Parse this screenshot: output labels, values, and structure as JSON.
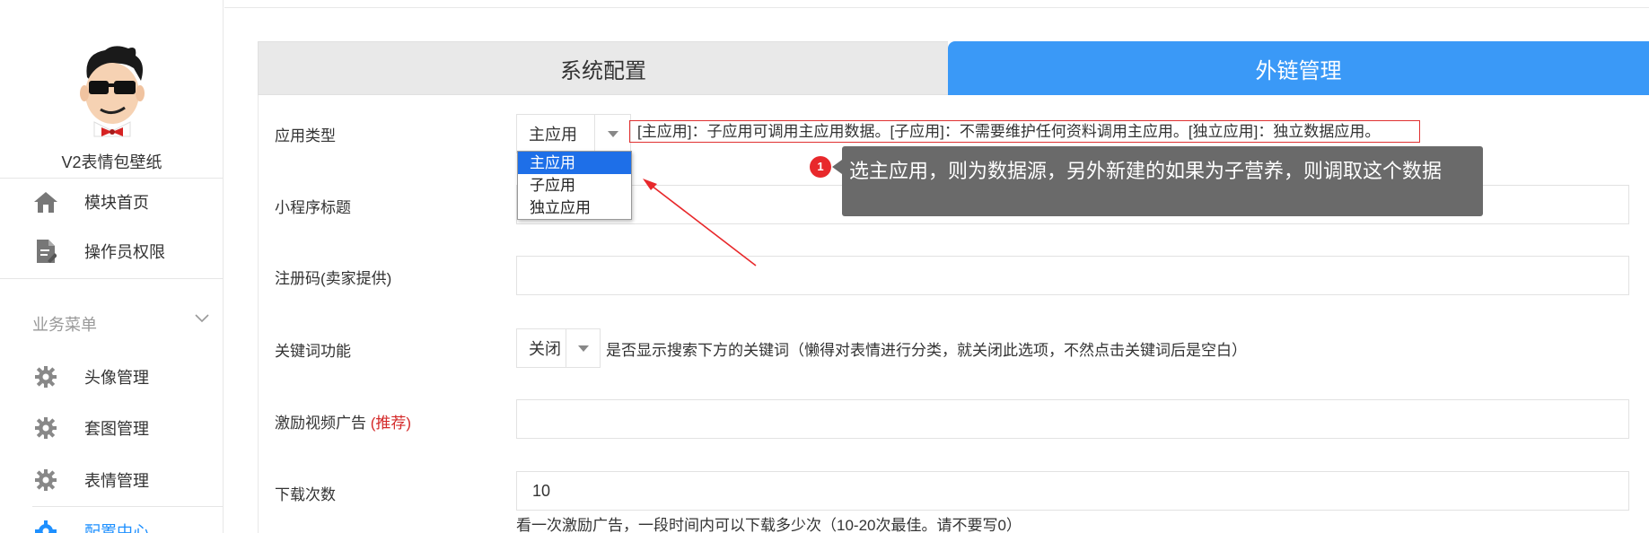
{
  "sidebar": {
    "site_name": "V2表情包壁纸",
    "top_items": [
      {
        "label": "模块首页",
        "icon": "home-icon"
      },
      {
        "label": "操作员权限",
        "icon": "document-edit-icon"
      }
    ],
    "group": {
      "label": "业务菜单",
      "icon": "chevron-down-icon"
    },
    "group_items": [
      {
        "label": "头像管理",
        "icon": "gear-icon"
      },
      {
        "label": "套图管理",
        "icon": "gear-icon"
      },
      {
        "label": "表情管理",
        "icon": "gear-icon"
      },
      {
        "label": "配置中心",
        "icon": "gear-icon",
        "active": true
      }
    ]
  },
  "tabs": [
    {
      "label": "系统配置",
      "active": false
    },
    {
      "label": "外链管理",
      "active": true
    }
  ],
  "form": {
    "app_type": {
      "label": "应用类型",
      "value": "主应用",
      "hint": "[主应用]：子应用可调用主应用数据。[子应用]：不需要维护任何资料调用主应用。[独立应用]：独立数据应用。",
      "options": [
        "主应用",
        "子应用",
        "独立应用"
      ],
      "selected_option": "主应用"
    },
    "mini_title": {
      "label": "小程序标题",
      "value": ""
    },
    "reg_code": {
      "label": "注册码(卖家提供)",
      "value": ""
    },
    "keyword": {
      "label": "关键词功能",
      "value": "关闭",
      "hint": "是否显示搜索下方的关键词（懒得对表情进行分类，就关闭此选项，不然点击关键词后是空白）"
    },
    "reward_ad": {
      "label": "激励视频广告",
      "label_tag": "(推荐)",
      "value": ""
    },
    "download_count": {
      "label": "下载次数",
      "value": "10",
      "hint": "看一次激励广告，一段时间内可以下载多少次（10-20次最佳。请不要写0）"
    }
  },
  "annotation": {
    "badge": "1",
    "text": "选主应用，则为数据源，另外新建的如果为子营养，则调取这个数据"
  },
  "colors": {
    "accent": "#3a99f7",
    "dropdown_highlight": "#1e6fe8",
    "annotation_red": "#e8282b",
    "tooltip_bg": "#6a6a6a",
    "hint_border": "#e03131"
  }
}
